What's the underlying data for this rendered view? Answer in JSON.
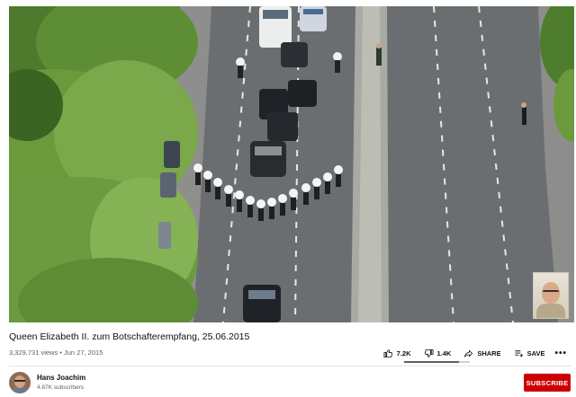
{
  "video": {
    "title": "Queen Elizabeth II. zum Botschafterempfang, 25.06.2015",
    "views": "3,329,731 views",
    "separator": " • ",
    "date": "Jun 27, 2015"
  },
  "actions": {
    "like_count": "7.2K",
    "dislike_count": "1.4K",
    "share_label": "SHARE",
    "save_label": "SAVE",
    "more_label": "•••",
    "like_ratio": 0.84
  },
  "channel": {
    "name": "Hans Joachim",
    "subscribers": "4.87K subscribers",
    "subscribe_label": "SUBSCRIBE"
  },
  "icons": {
    "like": "thumbs-up-icon",
    "dislike": "thumbs-down-icon",
    "share": "share-icon",
    "save": "playlist-add-icon"
  },
  "colors": {
    "subscribe_bg": "#cc0000",
    "road": "#6d7072",
    "trees": "#5f8f3a"
  }
}
